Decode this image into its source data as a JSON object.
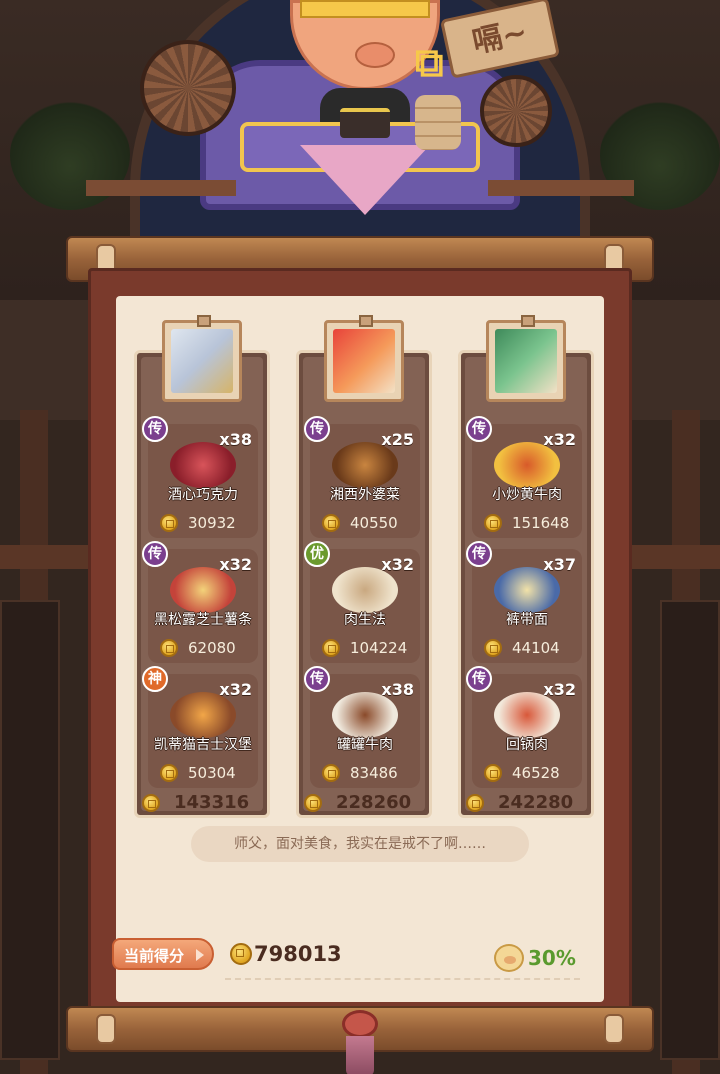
{
  "scene": {
    "sign_text": "嗝~"
  },
  "colors": {
    "badge_legend": "#7b3f8e",
    "badge_excellent": "#6b9a2e",
    "badge_divine": "#e06a2a",
    "score_positive": "#5a9a2e"
  },
  "columns": [
    {
      "portrait_icon": "hero-icon-white-hair",
      "dishes": [
        {
          "grade": "传",
          "count": "x38",
          "name": "酒心巧克力",
          "price": "30932",
          "icon": "chocolate-icon"
        },
        {
          "grade": "传",
          "count": "x32",
          "name": "黑松露芝士薯条",
          "price": "62080",
          "icon": "fries-icon"
        },
        {
          "grade": "神",
          "count": "x32",
          "name": "凯蒂猫吉士汉堡",
          "price": "50304",
          "icon": "burger-icon"
        }
      ],
      "total": "143316"
    },
    {
      "portrait_icon": "hero-icon-red-hair",
      "dishes": [
        {
          "grade": "传",
          "count": "x25",
          "name": "湘西外婆菜",
          "price": "40550",
          "icon": "stew-icon"
        },
        {
          "grade": "优",
          "count": "x32",
          "name": "肉生法",
          "price": "104224",
          "icon": "noodle-plate-icon"
        },
        {
          "grade": "传",
          "count": "x38",
          "name": "罐罐牛肉",
          "price": "83486",
          "icon": "pot-beef-icon"
        }
      ],
      "total": "228260"
    },
    {
      "portrait_icon": "hero-icon-green-hair",
      "dishes": [
        {
          "grade": "传",
          "count": "x32",
          "name": "小炒黄牛肉",
          "price": "151648",
          "icon": "stirfry-beef-icon"
        },
        {
          "grade": "传",
          "count": "x37",
          "name": "裤带面",
          "price": "44104",
          "icon": "noodle-bowl-icon"
        },
        {
          "grade": "传",
          "count": "x32",
          "name": "回锅肉",
          "price": "46528",
          "icon": "pork-plate-icon"
        }
      ],
      "total": "242280"
    }
  ],
  "speech": "师父，面对美食，我实在是戒不了啊……",
  "footer": {
    "score_label": "当前得分",
    "total_score": "798013",
    "percent": "30%"
  }
}
